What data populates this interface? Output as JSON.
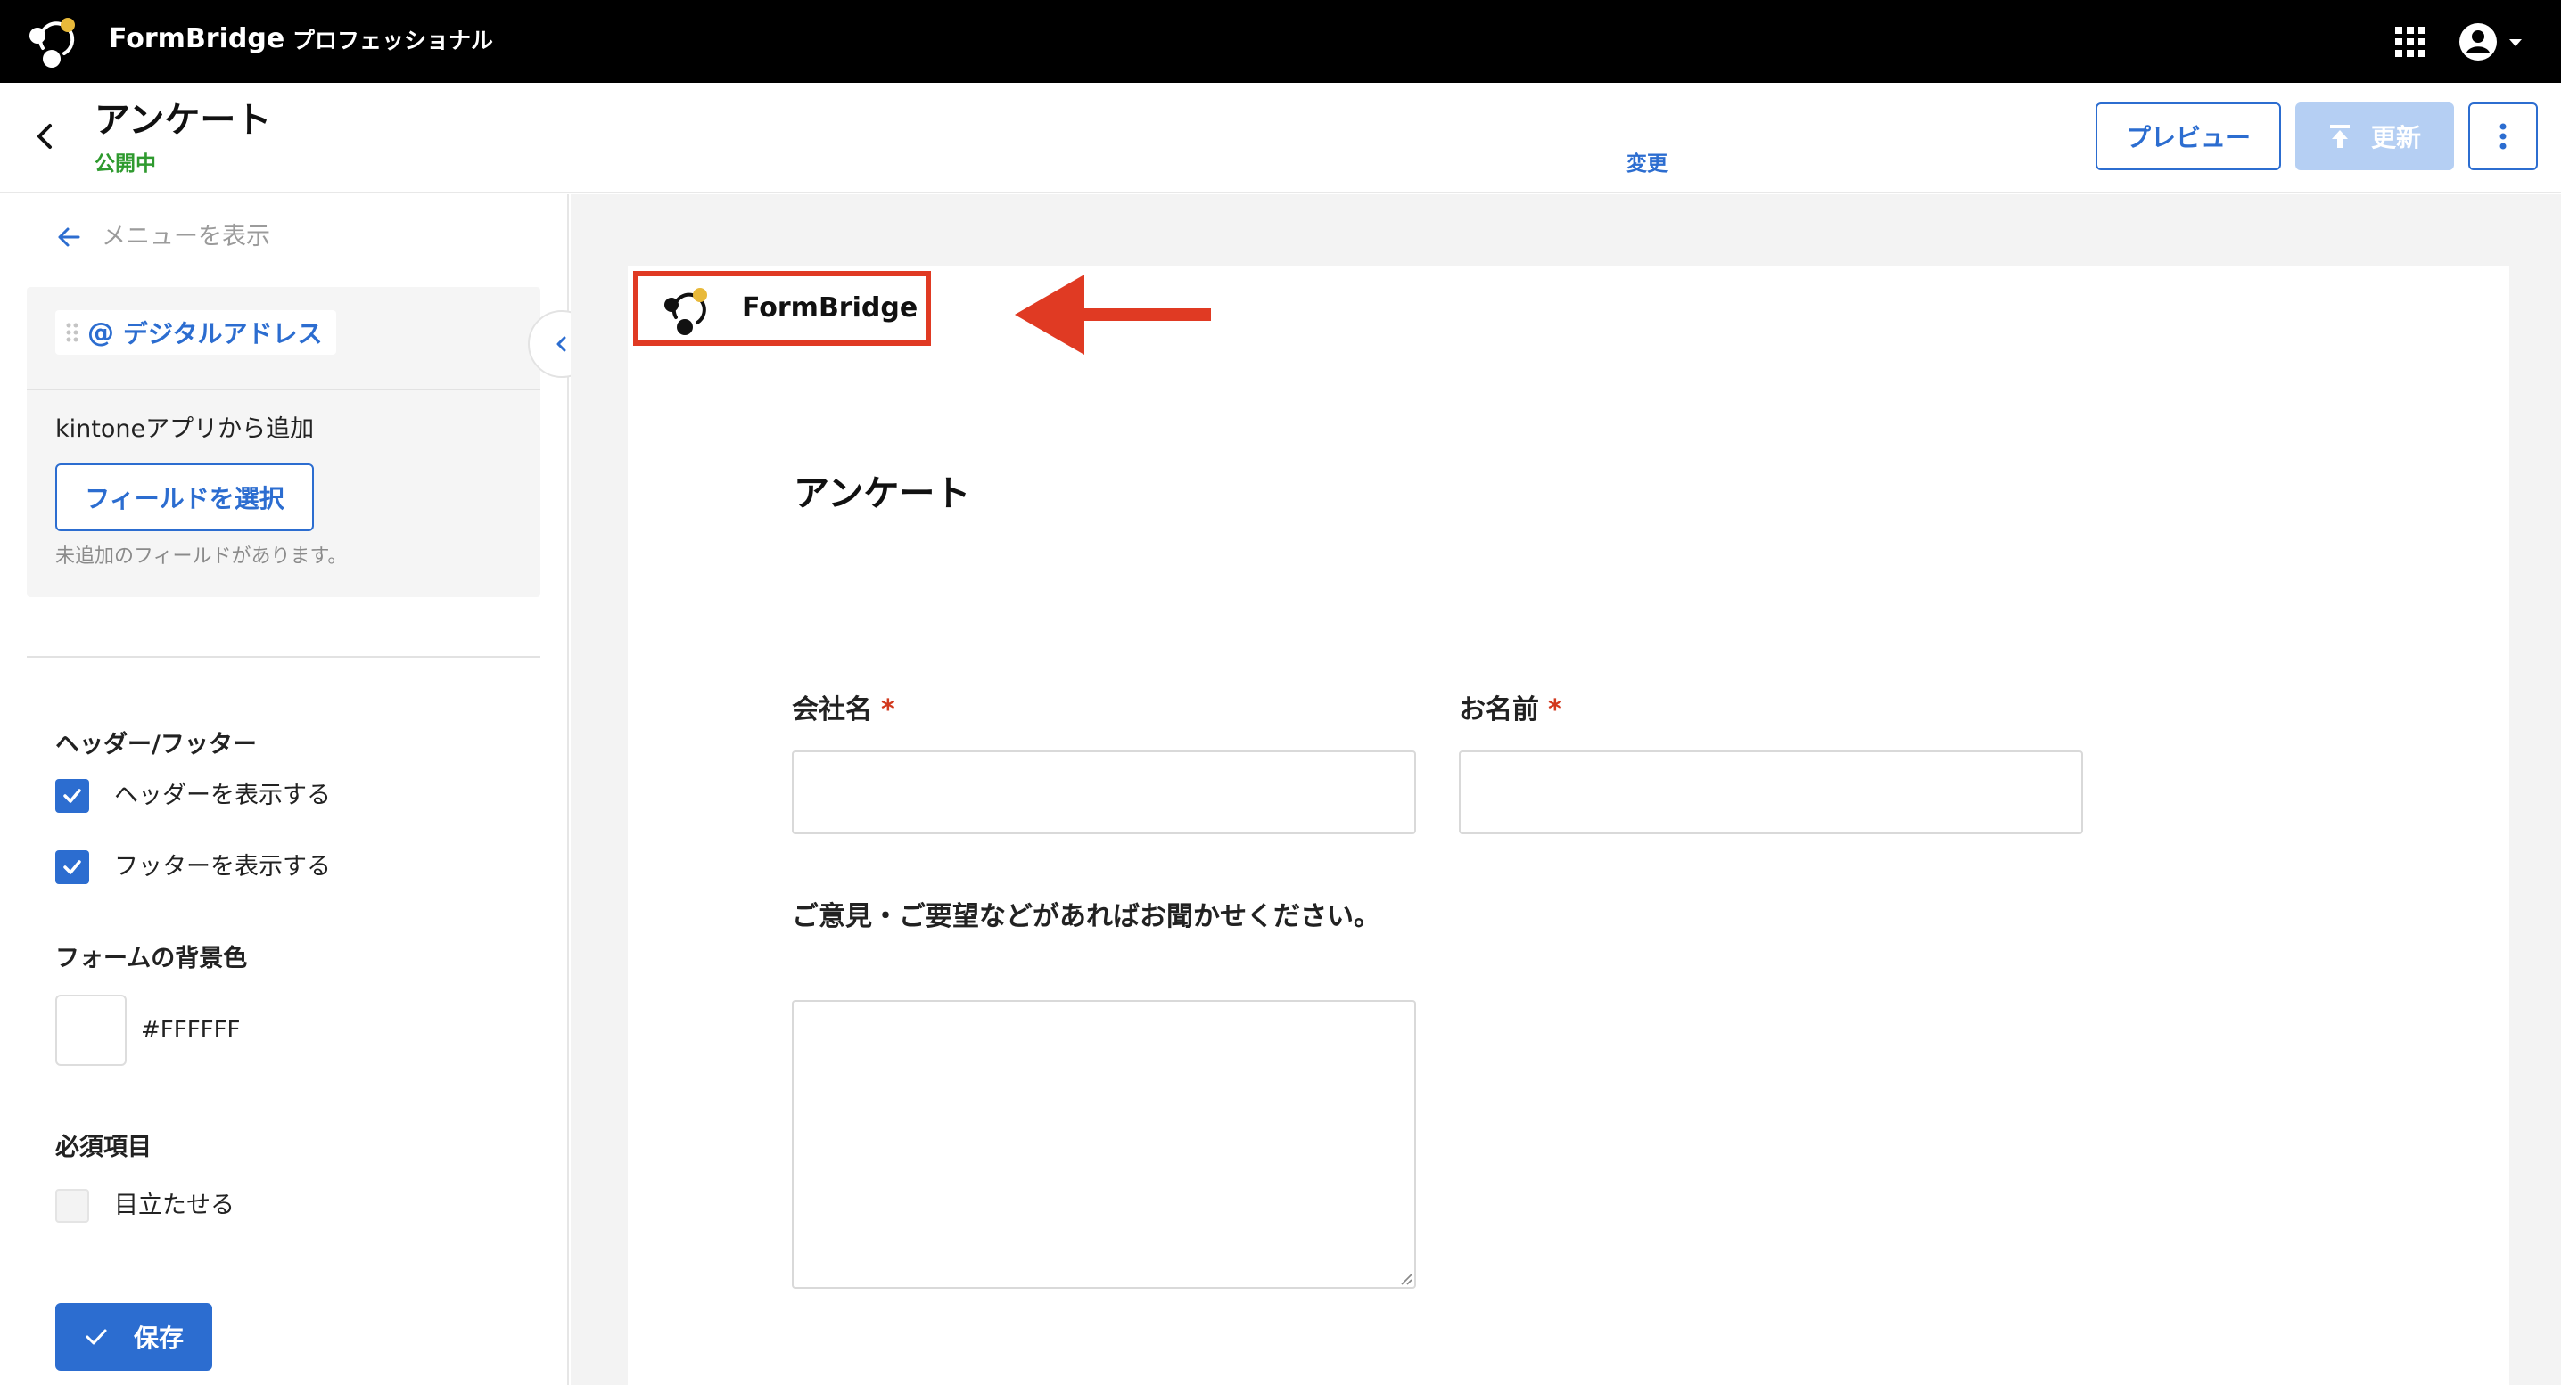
{
  "appbar": {
    "app_name": "FormBridge",
    "plan": "プロフェッショナル"
  },
  "header": {
    "title": "アンケート",
    "status": "公開中",
    "change_link": "変更",
    "preview_label": "プレビュー",
    "update_label": "更新"
  },
  "sidebar": {
    "menu_toggle_label": "メニューを表示",
    "field_chip_label": "デジタルアドレス",
    "kintone_label": "kintoneアプリから追加",
    "select_field_label": "フィールドを選択",
    "unadded_note": "未追加のフィールドがあります。",
    "header_footer": {
      "heading": "ヘッダー/フッター",
      "show_header_label": "ヘッダーを表示する",
      "show_header_checked": true,
      "show_footer_label": "フッターを表示する",
      "show_footer_checked": true
    },
    "background": {
      "heading": "フォームの背景色",
      "color": "#FFFFFF"
    },
    "required": {
      "heading": "必須項目",
      "highlight_label": "目立たせる",
      "highlight_checked": false
    },
    "save_label": "保存"
  },
  "form": {
    "logo_text": "FormBridge",
    "title": "アンケート",
    "fields": [
      {
        "label": "会社名",
        "required_mark": "*"
      },
      {
        "label": "お名前",
        "required_mark": "*"
      }
    ],
    "comment_label": "ご意見・ご要望などがあればお聞かせください。"
  },
  "colors": {
    "accent": "#2c6dd0",
    "status_green": "#2f9a2f",
    "annotation_red": "#e03a23",
    "logo_yellow": "#e8b93a",
    "update_disabled": "#b5cff3"
  }
}
